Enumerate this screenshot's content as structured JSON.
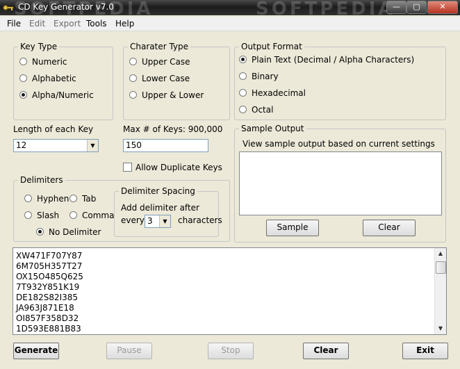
{
  "window": {
    "title": "CD Key Generator v7.0",
    "watermark": "SOFTPEDIA"
  },
  "menu": [
    "File",
    "Edit",
    "Export",
    "Tools",
    "Help"
  ],
  "key_type": {
    "legend": "Key Type",
    "options": [
      "Numeric",
      "Alphabetic",
      "Alpha/Numeric"
    ],
    "selected": 2
  },
  "charater_type": {
    "legend": "Charater Type",
    "options": [
      "Upper Case",
      "Lower Case",
      "Upper & Lower"
    ]
  },
  "output_format": {
    "legend": "Output Format",
    "options": [
      "Plain Text (Decimal / Alpha Characters)",
      "Binary",
      "Hexadecimal",
      "Octal"
    ],
    "selected": 0
  },
  "length": {
    "label": "Length of each Key",
    "value": "12"
  },
  "max_keys": {
    "label": "Max # of Keys: 900,000",
    "value": "150"
  },
  "allow_duplicates": {
    "label": "Allow Duplicate Keys",
    "checked": false
  },
  "sample_output": {
    "legend": "Sample Output",
    "description": "View sample output based on current settings",
    "sample_button": "Sample",
    "clear_button": "Clear"
  },
  "delimiters": {
    "legend": "Delimiters",
    "options": [
      "Hyphen",
      "Tab",
      "Slash",
      "Comma",
      "No Delimiter"
    ],
    "selected": 4
  },
  "delimiter_spacing": {
    "legend": "Delimiter Spacing",
    "line1": "Add delimiter after",
    "every": "every",
    "value": "3",
    "characters": "characters"
  },
  "keys": [
    "XW471F707Y87",
    "6M705H357T27",
    "OX15O485Q625",
    "7T932Y851K19",
    "DE182S82I385",
    "JA963J871E18",
    "OI857F358D32",
    "1D593E881B83"
  ],
  "buttons": {
    "generate": "Generate",
    "pause": "Pause",
    "stop": "Stop",
    "clear": "Clear",
    "exit": "Exit"
  }
}
